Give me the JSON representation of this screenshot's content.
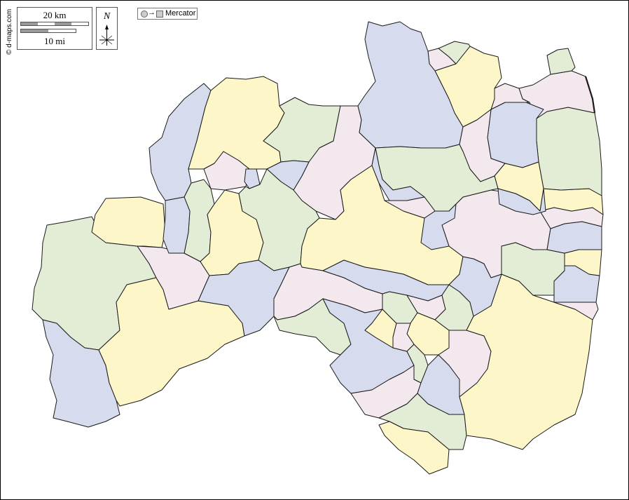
{
  "credit": "© d-maps.com",
  "scale": {
    "km_label": "20 km",
    "mi_label": "10 mi"
  },
  "north": {
    "label": "N"
  },
  "projection": {
    "label": "Mercator",
    "arrow": "→"
  },
  "colors": {
    "yellow": "#fdf6c9",
    "green": "#e3edd5",
    "blue": "#d6dcee",
    "pink": "#f4e8ef",
    "border": "#1a1a1a"
  }
}
